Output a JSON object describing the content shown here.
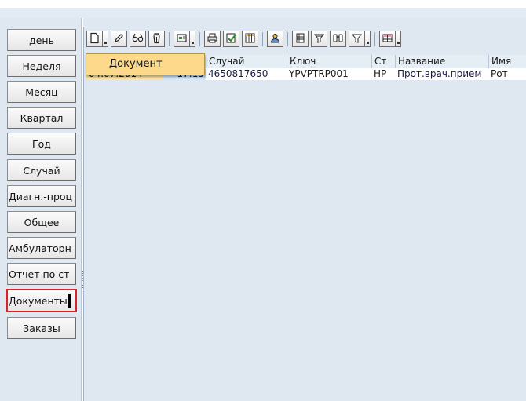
{
  "nav": {
    "items": [
      {
        "label": "день"
      },
      {
        "label": "Неделя"
      },
      {
        "label": "Месяц"
      },
      {
        "label": "Квартал"
      },
      {
        "label": "Год"
      },
      {
        "label": "Случай"
      },
      {
        "label": "Диагн.-проц"
      },
      {
        "label": "Общее"
      },
      {
        "label": "Амбулаторн"
      },
      {
        "label": "Отчет по ст"
      },
      {
        "label": "Документы"
      },
      {
        "label": "Заказы"
      }
    ],
    "active_item": "Документы"
  },
  "toolbar": {
    "icons": [
      "new-document-icon",
      "edit-pencil-icon",
      "glasses-display-icon",
      "trash-icon",
      "document-options-icon",
      "print-icon",
      "check-approve-icon",
      "table-grid-icon",
      "person-icon",
      "print-list-icon",
      "filter-icon",
      "find-binoculars-icon",
      "set-filter-icon",
      "layout-icon"
    ]
  },
  "dropdown": {
    "label": "Документ"
  },
  "table": {
    "columns": [
      "Случай",
      "Ключ",
      "Ст",
      "Название",
      "Имя"
    ],
    "rows": [
      {
        "date": "04.07.2014",
        "time": "17:15",
        "case": "4650817650",
        "key": "YPVPTRP001",
        "status": "НР",
        "name": "Прот.врач.прием",
        "person": "Рот"
      }
    ]
  },
  "colors": {
    "active_border": "#d9222a",
    "dropdown_bg": "#fdd98b",
    "panel_bg": "#dfe8f1"
  }
}
